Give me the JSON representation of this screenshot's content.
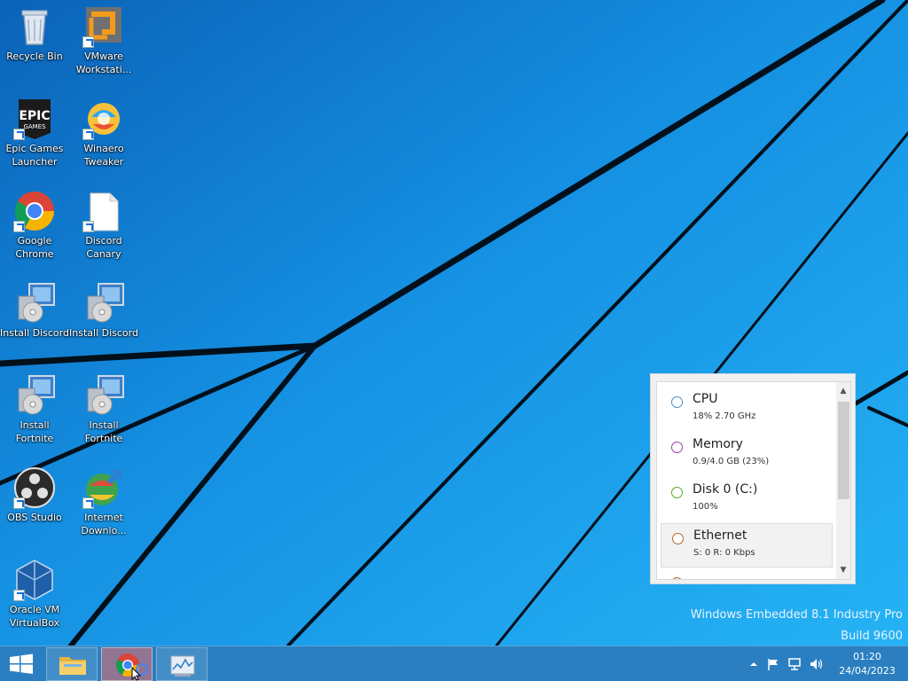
{
  "desktop": {
    "icons": [
      {
        "label": "Recycle Bin",
        "icon": "recycle-bin-icon"
      },
      {
        "label": "VMware Workstati...",
        "icon": "vmware-icon"
      },
      {
        "label": "Epic Games Launcher",
        "icon": "epic-games-icon"
      },
      {
        "label": "Winaero Tweaker",
        "icon": "winaero-icon"
      },
      {
        "label": "Google Chrome",
        "icon": "chrome-icon"
      },
      {
        "label": "Discord Canary",
        "icon": "file-icon"
      },
      {
        "label": "Install Discord",
        "icon": "installer-icon"
      },
      {
        "label": "Install Discord",
        "icon": "installer-icon"
      },
      {
        "label": "Install Fortnite",
        "icon": "installer-icon"
      },
      {
        "label": "Install Fortnite",
        "icon": "installer-icon"
      },
      {
        "label": "OBS Studio",
        "icon": "obs-icon"
      },
      {
        "label": "Internet Downlo...",
        "icon": "idm-icon"
      },
      {
        "label": "Oracle VM VirtualBox",
        "icon": "virtualbox-icon"
      }
    ],
    "watermark": {
      "line1": "Windows Embedded 8.1 Industry Pro",
      "line2": "Build 9600"
    }
  },
  "performance": {
    "items": [
      {
        "name": "CPU",
        "value": "18%  2.70 GHz",
        "color": "#4a90c8"
      },
      {
        "name": "Memory",
        "value": "0.9/4.0 GB (23%)",
        "color": "#9b3fb0"
      },
      {
        "name": "Disk 0 (C:)",
        "value": "100%",
        "color": "#5aa832"
      },
      {
        "name": "Ethernet",
        "value": "S: 0 R: 0 Kbps",
        "color": "#b06a2a"
      }
    ],
    "selected_index": 3
  },
  "taskbar": {
    "buttons": [
      {
        "name": "file-explorer",
        "icon": "folder-icon"
      },
      {
        "name": "google-chrome",
        "icon": "chrome-icon"
      },
      {
        "name": "task-manager",
        "icon": "task-manager-icon"
      }
    ],
    "tray_icons": [
      "chevron-up-icon",
      "flag-icon",
      "network-icon",
      "speaker-icon"
    ],
    "clock": {
      "time": "01:20",
      "date": "24/04/2023"
    }
  },
  "colors": {
    "wallpaper": "#1a8fe0",
    "taskbar": "#2b7fc0"
  }
}
